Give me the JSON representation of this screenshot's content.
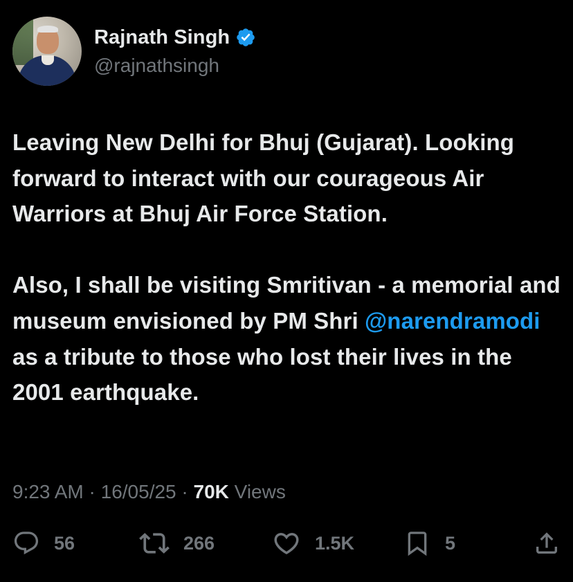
{
  "author": {
    "display_name": "Rajnath Singh",
    "handle": "@rajnathsingh",
    "verified": true,
    "verified_color": "#1d9bf0"
  },
  "tweet": {
    "para1": "Leaving New Delhi for Bhuj (Gujarat). Looking forward to interact with our courageous Air Warriors at Bhuj Air Force Station.",
    "para2_before": "Also, I shall be visiting Smritivan - a memorial and museum envisioned by PM Shri ",
    "mention": "@narendramodi",
    "para2_after": " as a tribute to those who lost their lives in the 2001 earthquake."
  },
  "meta": {
    "time": "9:23 AM",
    "sep1": " · ",
    "date": "16/05/25",
    "sep2": " · ",
    "views_count": "70K",
    "views_label": " Views"
  },
  "actions": {
    "replies": "56",
    "reposts": "266",
    "likes": "1.5K",
    "bookmarks": "5",
    "icons": [
      "reply-icon",
      "repost-icon",
      "like-icon",
      "bookmark-icon",
      "share-icon"
    ]
  },
  "colors": {
    "background": "#000000",
    "text": "#e7e9ea",
    "secondary": "#71767b",
    "link": "#1d9bf0"
  }
}
